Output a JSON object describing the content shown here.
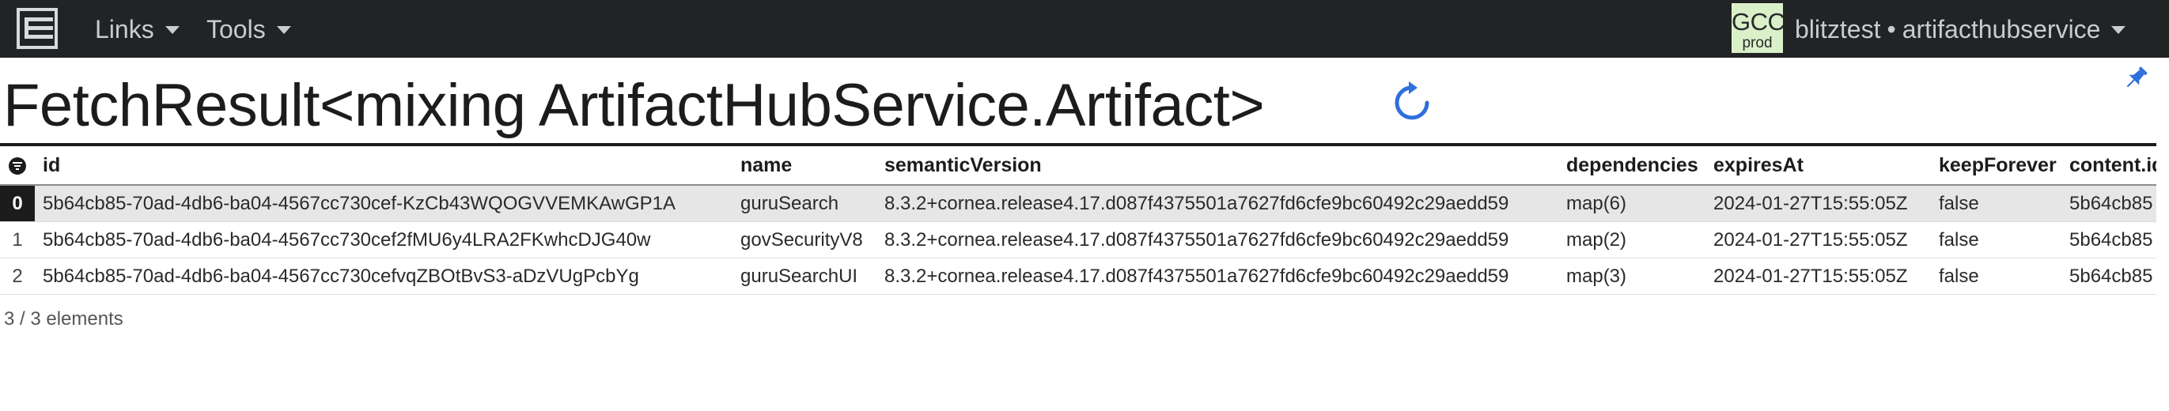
{
  "navbar": {
    "logo_icon": "stacked-brackets-logo-icon",
    "menus": [
      {
        "label": "Links"
      },
      {
        "label": "Tools"
      }
    ],
    "env_badge": {
      "code": "GCC",
      "env": "prod",
      "color": "#d9f0c9"
    },
    "workspace": {
      "user": "blitztest",
      "separator": "•",
      "service": "artifacthubservice"
    }
  },
  "page": {
    "title": "FetchResult<mixing ArtifactHubService.Artifact>",
    "refresh_icon": "refresh-icon",
    "pin_icon": "pin-icon",
    "accent_color": "#2f6fde"
  },
  "table": {
    "columns": [
      "id",
      "name",
      "semanticVersion",
      "dependencies",
      "expiresAt",
      "keepForever",
      "content.id"
    ],
    "rows": [
      {
        "index": "0",
        "id": "5b64cb85-70ad-4db6-ba04-4567cc730cef-KzCb43WQOGVVEMKAwGP1A",
        "name": "guruSearch",
        "semanticVersion": "8.3.2+cornea.release4.17.d087f4375501a7627fd6cfe9bc60492c29aedd59",
        "dependencies": "map(6)",
        "expiresAt": "2024-01-27T15:55:05Z",
        "keepForever": "false",
        "content_id": "5b64cb85",
        "selected": true
      },
      {
        "index": "1",
        "id": "5b64cb85-70ad-4db6-ba04-4567cc730cef2fMU6y4LRA2FKwhcDJG40w",
        "name": "govSecurityV8",
        "semanticVersion": "8.3.2+cornea.release4.17.d087f4375501a7627fd6cfe9bc60492c29aedd59",
        "dependencies": "map(2)",
        "expiresAt": "2024-01-27T15:55:05Z",
        "keepForever": "false",
        "content_id": "5b64cb85",
        "selected": false
      },
      {
        "index": "2",
        "id": "5b64cb85-70ad-4db6-ba04-4567cc730cefvqZBOtBvS3-aDzVUgPcbYg",
        "name": "guruSearchUI",
        "semanticVersion": "8.3.2+cornea.release4.17.d087f4375501a7627fd6cfe9bc60492c29aedd59",
        "dependencies": "map(3)",
        "expiresAt": "2024-01-27T15:55:05Z",
        "keepForever": "false",
        "content_id": "5b64cb85",
        "selected": false
      }
    ],
    "count_label": "3 / 3 elements"
  }
}
